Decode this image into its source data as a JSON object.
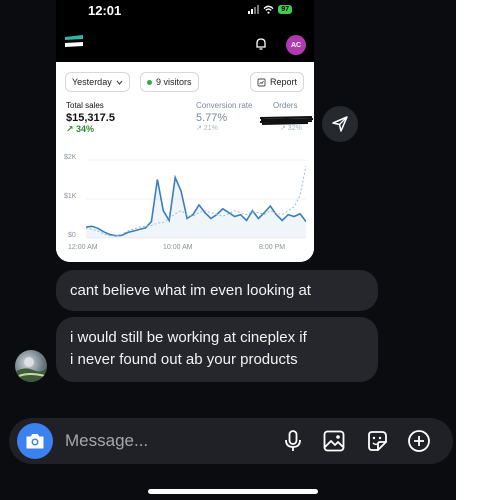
{
  "screenshot": {
    "status_time": "12:01",
    "battery": "97",
    "avatar_initials": "AC",
    "date_filter": "Yesterday",
    "visitors": "9 visitors",
    "report_label": "Report",
    "metrics": {
      "total_sales_label": "Total sales",
      "total_sales_value": "$15,317.5",
      "total_sales_change": "↗ 34%",
      "conversion_label": "Conversion rate",
      "conversion_value": "5.77%",
      "conversion_change": "↗ 21%",
      "orders_label": "Orders",
      "orders_change": "↗ 32%"
    },
    "chart_data": {
      "type": "line",
      "y_ticks": [
        "$2K",
        "$1K",
        "$0"
      ],
      "ylim": [
        0,
        2000
      ],
      "x_ticks": [
        "12:00 AM",
        "10:00 AM",
        "8:00 PM"
      ],
      "series": [
        {
          "values": [
            280,
            300,
            250,
            160,
            90,
            60,
            70,
            140,
            180,
            220,
            260,
            420,
            1500,
            700,
            450,
            1550,
            1200,
            500,
            600,
            850,
            650,
            500,
            600,
            750,
            650,
            550,
            600,
            450,
            700,
            500,
            650,
            820,
            600,
            450,
            600,
            550,
            620,
            420
          ]
        },
        {
          "values": [
            260,
            220,
            180,
            100,
            60,
            50,
            90,
            180,
            230,
            280,
            300,
            320,
            380,
            400,
            500,
            620,
            700,
            600,
            560,
            650,
            700,
            650,
            600,
            560,
            620,
            700,
            650,
            600,
            680,
            650,
            600,
            700,
            640,
            600,
            700,
            800,
            1100,
            1850
          ]
        }
      ],
      "colors": [
        "#3a7ebf",
        "#8fc3dc"
      ]
    }
  },
  "messages": [
    {
      "text": "cant believe what im even looking at"
    },
    {
      "line1": "i would still be working at cineplex if",
      "line2": "i never found out ab your products"
    }
  ],
  "composer": {
    "placeholder": "Message...",
    "icons": [
      "camera-icon",
      "microphone-icon",
      "image-icon",
      "sticker-icon",
      "plus-icon"
    ]
  },
  "colors": {
    "background": "#0b0c0f",
    "bubble": "#25272c",
    "camera_button": "#3b82f0",
    "sales_up": "#2e8a3a"
  }
}
